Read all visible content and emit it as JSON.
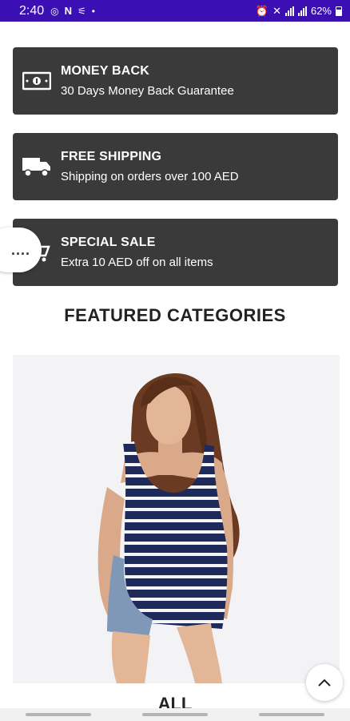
{
  "status_bar": {
    "time": "2:40",
    "left_icons": [
      "whatsapp-icon",
      "netflix-icon",
      "notification-icon",
      "dot-icon"
    ],
    "n_glyph": "N",
    "battery": "62%"
  },
  "features": [
    {
      "title": "MONEY BACK",
      "subtitle": "30 Days Money Back Guarantee",
      "icon": "money-icon"
    },
    {
      "title": "FREE SHIPPING",
      "subtitle": "Shipping on orders over 100 AED",
      "icon": "truck-icon"
    },
    {
      "title": "SPECIAL SALE",
      "subtitle": "Extra 10 AED off on all items",
      "icon": "cart-icon"
    }
  ],
  "floating_more": {
    "label": "...."
  },
  "featured": {
    "title": "FEATURED CATEGORIES",
    "first_category": {
      "label": "ALL",
      "image": "model-in-striped-tank-top"
    }
  },
  "colors": {
    "status_bar": "#3b0fb5",
    "card_bg": "#3a3a3a",
    "stripe_navy": "#1e2a5a"
  }
}
